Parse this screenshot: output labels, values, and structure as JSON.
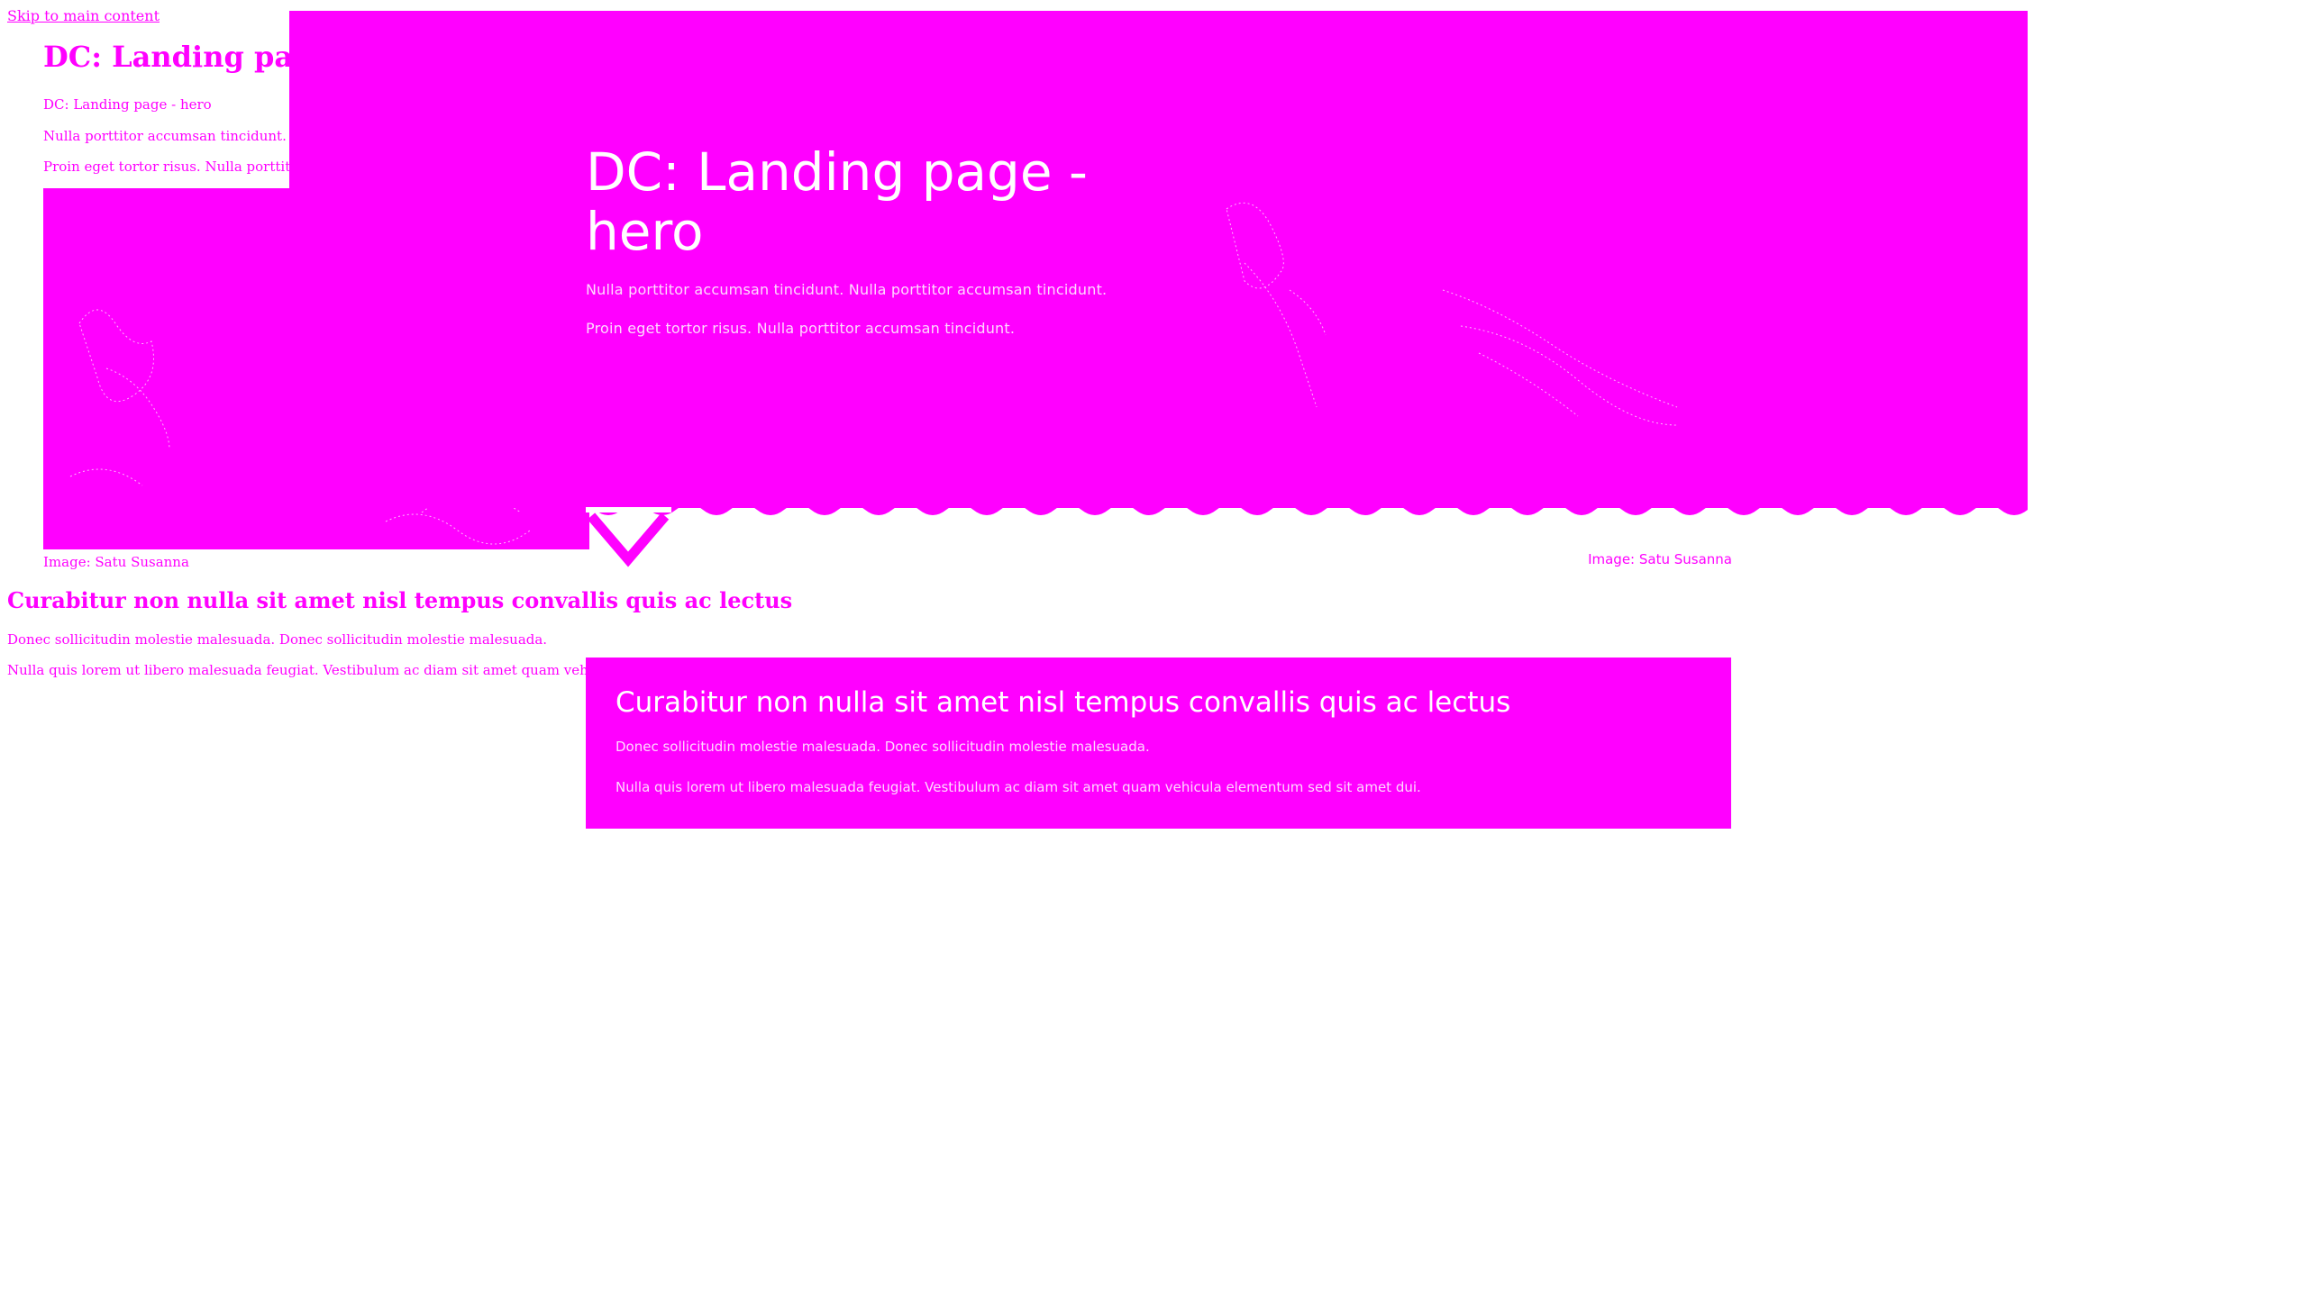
{
  "skip_link": "Skip to main content",
  "hero": {
    "title": "DC: Landing page - hero",
    "paragraphs": [
      "Nulla porttitor accumsan tincidunt. Nulla porttitor accumsan tincidunt.",
      "Proin eget tortor risus. Nulla porttitor accumsan tincidunt."
    ],
    "caption": "Image: Satu Susanna"
  },
  "base": {
    "title_truncated": "DC: Landing page -",
    "subtitle": "DC: Landing page - hero",
    "p1_truncated": "Nulla porttitor accumsan tincidunt. Nulla p",
    "p2_truncated": "Proin eget tortor risus. Nulla porttitor accu",
    "caption": "Image: Satu Susanna",
    "section_title": "Curabitur non nulla sit amet nisl tempus convallis quis ac lectus",
    "section_p1": "Donec sollicitudin molestie malesuada. Donec sollicitudin molestie malesuada.",
    "section_p2_truncated": "Nulla quis lorem ut libero malesuada feugiat. Vestibulum ac diam sit amet quam vehicula elementum"
  },
  "card": {
    "title": "Curabitur non nulla sit amet nisl tempus convallis quis ac lectus",
    "paragraphs": [
      "Donec sollicitudin molestie malesuada. Donec sollicitudin molestie malesuada.",
      "Nulla quis lorem ut libero malesuada feugiat. Vestibulum ac diam sit amet quam vehicula elementum sed sit amet dui."
    ]
  },
  "colors": {
    "accent": "#ff00ff",
    "background": "#ffffff",
    "hero_text": "#ffffff"
  },
  "icons": {
    "scroll_down": "chevron-down-icon",
    "wave": "wave-divider"
  }
}
